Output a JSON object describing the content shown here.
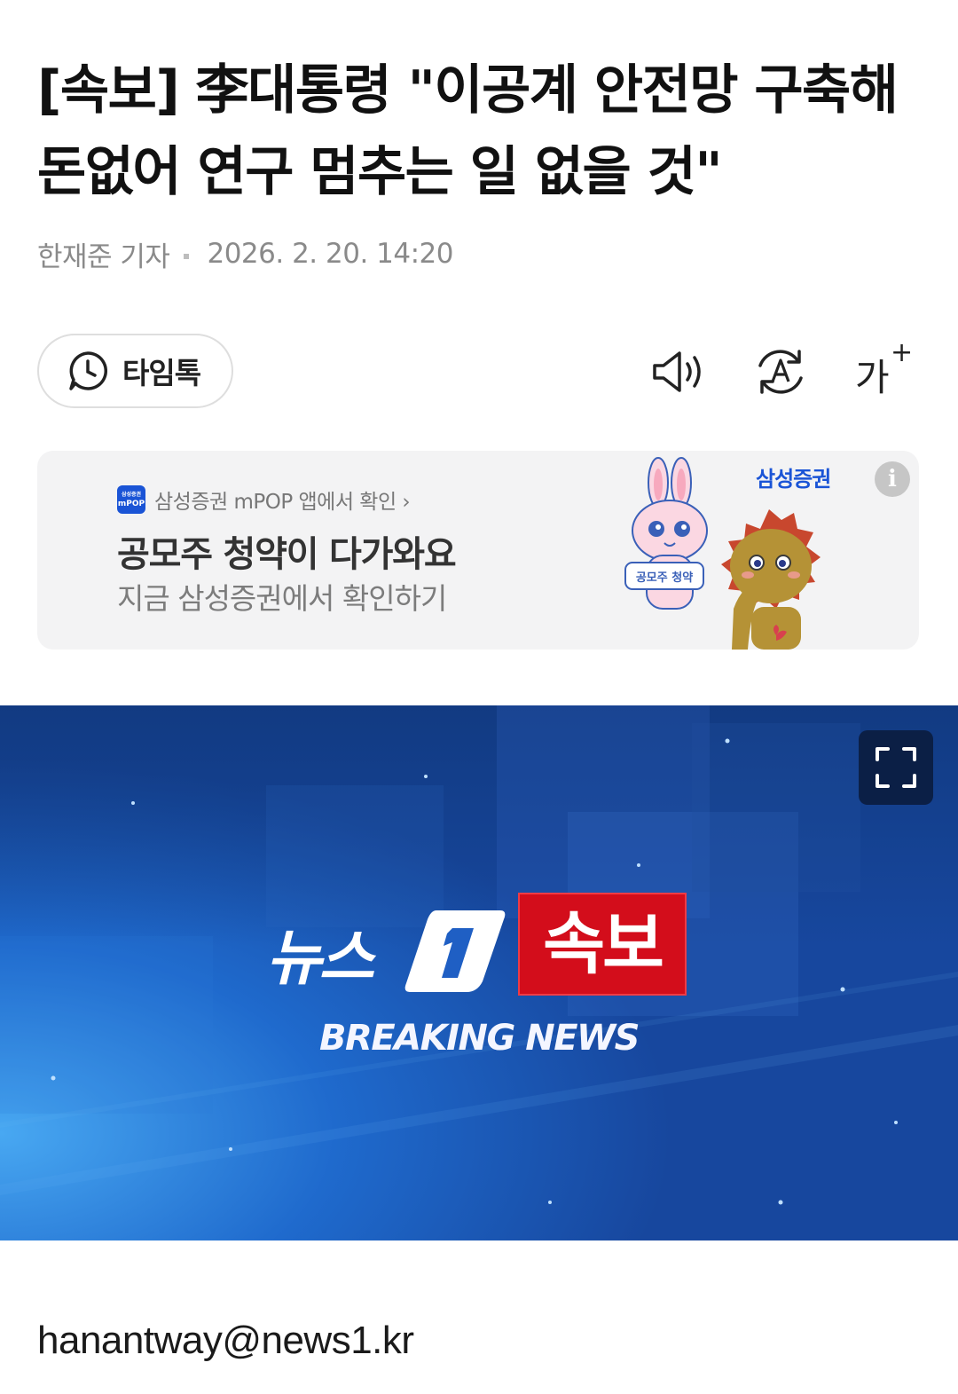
{
  "article": {
    "headline": "[속보] 李대통령 \"이공계 안전망 구축해 돈없어 연구 멈추는 일 없을 것\"",
    "reporter": "한재준 기자",
    "timestamp": "2026. 2. 20. 14:20"
  },
  "toolbar": {
    "timetalk_label": "타임톡",
    "tts_icon": "speaker-icon",
    "translate_icon": "auto-translate-icon",
    "font_size_label": "가",
    "font_size_plus": "+"
  },
  "ad": {
    "brand_logo_small": "삼성증권",
    "brand_logo_main": "mPOP",
    "brand_line": "삼성증권 mPOP 앱에서 확인 ›",
    "title": "공모주 청약이 다가와요",
    "subtitle": "지금 삼성증권에서 확인하기",
    "advertiser_logo": "삼성증권",
    "info_glyph": "i",
    "sign_text": "공모주 청약"
  },
  "hero": {
    "logo_text": "뉴스",
    "logo_badge": "1",
    "breaking_label": "속보",
    "breaking_english": "BREAKING NEWS",
    "expand_icon": "fullscreen-icon",
    "colors": {
      "bg": "#1d5bc2",
      "red": "#d30d1b"
    }
  },
  "footer": {
    "email": "hanantway@news1.kr"
  }
}
